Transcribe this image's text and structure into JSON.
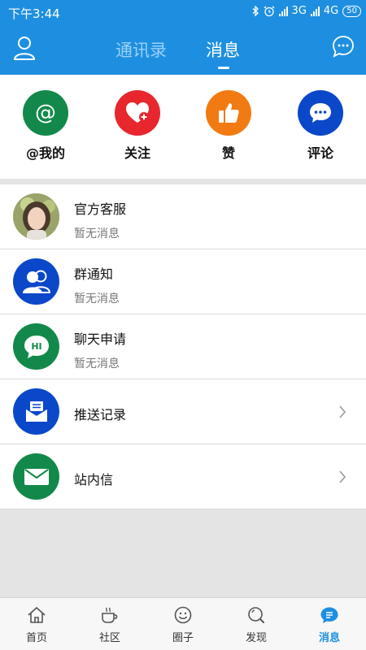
{
  "status_bar": {
    "time": "下午3:44",
    "network_1": "3G",
    "network_2": "4G",
    "battery": "50"
  },
  "header": {
    "tab_contacts": "通讯录",
    "tab_messages": "消息"
  },
  "quick_actions": [
    {
      "label": "@我的",
      "icon": "at-icon",
      "color": "#12894a"
    },
    {
      "label": "关注",
      "icon": "heart-plus-icon",
      "color": "#e8262e"
    },
    {
      "label": "赞",
      "icon": "thumbs-up-icon",
      "color": "#f27a12"
    },
    {
      "label": "评论",
      "icon": "comment-icon",
      "color": "#0b47c9"
    }
  ],
  "messages": [
    {
      "title": "官方客服",
      "subtitle": "暂无消息",
      "icon": "customer-service-avatar"
    },
    {
      "title": "群通知",
      "subtitle": "暂无消息",
      "icon": "group-icon",
      "color": "#0b47c9"
    },
    {
      "title": "聊天申请",
      "subtitle": "暂无消息",
      "icon": "hi-bubble-icon",
      "color": "#12894a",
      "icon_text": "HI"
    },
    {
      "title": "推送记录",
      "icon": "inbox-icon",
      "color": "#0b47c9"
    },
    {
      "title": "站内信",
      "icon": "mail-icon",
      "color": "#12894a"
    }
  ],
  "bottom_nav": [
    {
      "label": "首页",
      "icon": "home-icon"
    },
    {
      "label": "社区",
      "icon": "coffee-icon"
    },
    {
      "label": "圈子",
      "icon": "smile-circle-icon"
    },
    {
      "label": "发现",
      "icon": "search-icon"
    },
    {
      "label": "消息",
      "icon": "message-icon",
      "active": true
    }
  ],
  "colors": {
    "primary": "#1e8fe0",
    "background": "#e4e4e4"
  }
}
